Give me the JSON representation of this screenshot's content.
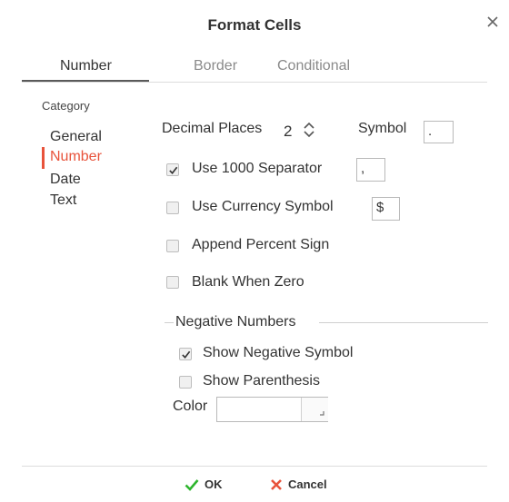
{
  "dialog": {
    "title": "Format Cells"
  },
  "tabs": [
    {
      "label": "Number",
      "active": true
    },
    {
      "label": "Border",
      "active": false
    },
    {
      "label": "Conditional",
      "active": false
    }
  ],
  "category": {
    "heading": "Category",
    "items": [
      {
        "label": "General",
        "selected": false
      },
      {
        "label": "Number",
        "selected": true
      },
      {
        "label": "Date",
        "selected": false
      },
      {
        "label": "Text",
        "selected": false
      }
    ]
  },
  "number": {
    "decimal_places_label": "Decimal Places",
    "decimal_places_value": "2",
    "symbol_label": "Symbol",
    "symbol_value": ".",
    "separator_label": "Use 1000 Separator",
    "separator_checked": true,
    "separator_value": ",",
    "currency_label": "Use Currency Symbol",
    "currency_checked": false,
    "currency_value": "$",
    "percent_label": "Append Percent Sign",
    "percent_checked": false,
    "blank_zero_label": "Blank When Zero",
    "blank_zero_checked": false
  },
  "negative": {
    "legend": "Negative Numbers",
    "show_symbol_label": "Show Negative Symbol",
    "show_symbol_checked": true,
    "show_parenthesis_label": "Show Parenthesis",
    "show_parenthesis_checked": false,
    "color_label": "Color",
    "color_value": ""
  },
  "footer": {
    "ok_label": "OK",
    "cancel_label": "Cancel"
  },
  "colors": {
    "accent": "#e8533b",
    "ok": "#2db52d",
    "cancel": "#e8533b",
    "text": "#333333",
    "muted": "#8a8a8a"
  }
}
